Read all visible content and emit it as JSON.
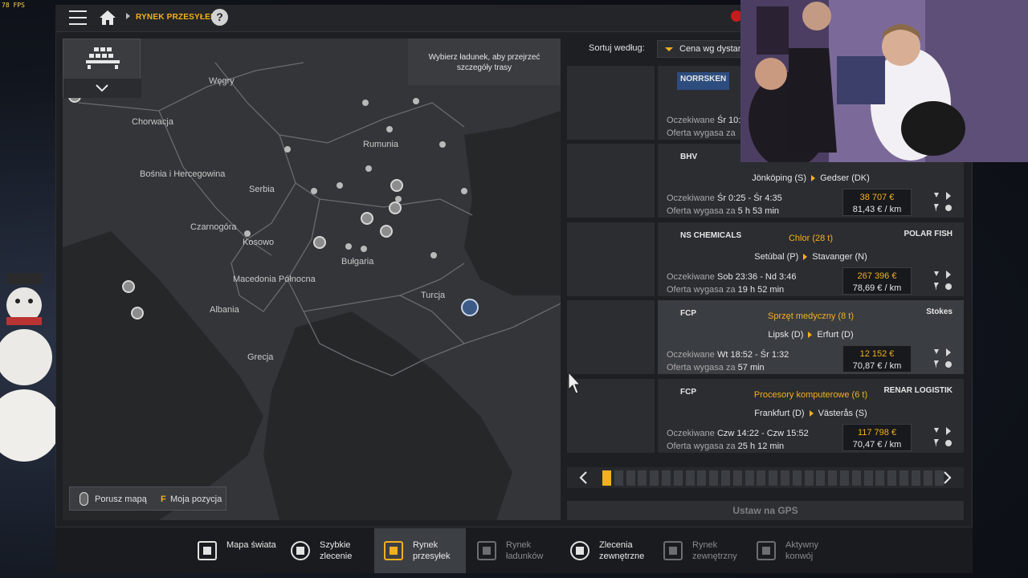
{
  "fps_text": "78 FPS",
  "header": {
    "breadcrumb": "RYNEK PRZESYŁEK",
    "help_label": "?"
  },
  "map": {
    "tooltip": "Wybierz ładunek, aby przejrzeć szczegóły trasy",
    "labels": [
      {
        "id": "wegry",
        "text": "Węgry"
      },
      {
        "id": "chorwacja",
        "text": "Chorwacja"
      },
      {
        "id": "rumunia",
        "text": "Rumunia"
      },
      {
        "id": "bosnia",
        "text": "Bośnia i Hercegowina"
      },
      {
        "id": "serbia",
        "text": "Serbia"
      },
      {
        "id": "czarnogora",
        "text": "Czarnogóra"
      },
      {
        "id": "kosowo",
        "text": "Kosowo"
      },
      {
        "id": "bulgaria",
        "text": "Bułgaria"
      },
      {
        "id": "macedonia",
        "text": "Macedonia Północna"
      },
      {
        "id": "turcja",
        "text": "Turcja"
      },
      {
        "id": "albania",
        "text": "Albania"
      },
      {
        "id": "grecja",
        "text": "Grecja"
      }
    ],
    "hint_move": "Porusz mapą",
    "hint_key": "F",
    "hint_position": "Moja pozycja"
  },
  "sort": {
    "label": "Sortuj według:",
    "value": "Cena wg dystansu"
  },
  "jobs": [
    {
      "logo_left": "NORRSKEN",
      "logo_right": "",
      "cargo": "",
      "from": "",
      "to": "",
      "expected_label": "Oczekiwane",
      "expected": "Śr 10:",
      "offer_label": "Oferta wygasa za",
      "offer": "",
      "price": "",
      "rate": ""
    },
    {
      "logo_left": "BHV",
      "logo_right": "",
      "cargo": "",
      "from": "Jönköping (S)",
      "to": "Gedser (DK)",
      "expected_label": "Oczekiwane",
      "expected": "Śr 0:25 - Śr 4:35",
      "offer_label": "Oferta wygasa za",
      "offer": "5 h 53 min",
      "price": "38 707 €",
      "rate": "81,43 € / km"
    },
    {
      "logo_left": "NS CHEMICALS",
      "logo_right": "POLAR FISH",
      "cargo": "Chlor (28 t)",
      "from": "Setúbal (P)",
      "to": "Stavanger (N)",
      "expected_label": "Oczekiwane",
      "expected": "Sob 23:36 - Nd 3:46",
      "offer_label": "Oferta wygasa za",
      "offer": "19 h 52 min",
      "price": "267 396 €",
      "rate": "78,69 € / km"
    },
    {
      "logo_left": "FCP",
      "logo_right": "Stokes",
      "cargo": "Sprzęt medyczny (8 t)",
      "from": "Lipsk (D)",
      "to": "Erfurt (D)",
      "expected_label": "Oczekiwane",
      "expected": "Wt 18:52 - Śr 1:32",
      "offer_label": "Oferta wygasa za",
      "offer": "57 min",
      "price": "12 152 €",
      "rate": "70,87 € / km"
    },
    {
      "logo_left": "FCP",
      "logo_right": "RENAR LOGISTIK",
      "cargo": "Procesory komputerowe (6 t)",
      "from": "Frankfurt (D)",
      "to": "Västerås (S)",
      "expected_label": "Oczekiwane",
      "expected": "Czw 14:22 - Czw 15:52",
      "offer_label": "Oferta wygasa za",
      "offer": "25 h 12 min",
      "price": "117 798 €",
      "rate": "70,47 € / km"
    }
  ],
  "pager": {
    "current_page": 1,
    "total_pages": 29
  },
  "gps_button": "Ustaw na GPS",
  "nav": [
    {
      "label": "Mapa świata",
      "icon": "world-map-icon"
    },
    {
      "label": "Szybkie\nzlecenie",
      "icon": "quick-job-icon"
    },
    {
      "label": "Rynek\nprzesyłek",
      "icon": "freight-market-icon"
    },
    {
      "label": "Rynek\nładunków",
      "icon": "cargo-market-icon"
    },
    {
      "label": "Zlecenia\nzewnętrzne",
      "icon": "external-contracts-icon"
    },
    {
      "label": "Rynek\nzewnętrzny",
      "icon": "external-market-icon"
    },
    {
      "label": "Aktywny\nkonwój",
      "icon": "active-convoy-icon"
    }
  ],
  "colors": {
    "accent": "#f2b01e",
    "panel": "#2b2d31",
    "selected": "#3a3d42",
    "map": "#2f3033"
  }
}
